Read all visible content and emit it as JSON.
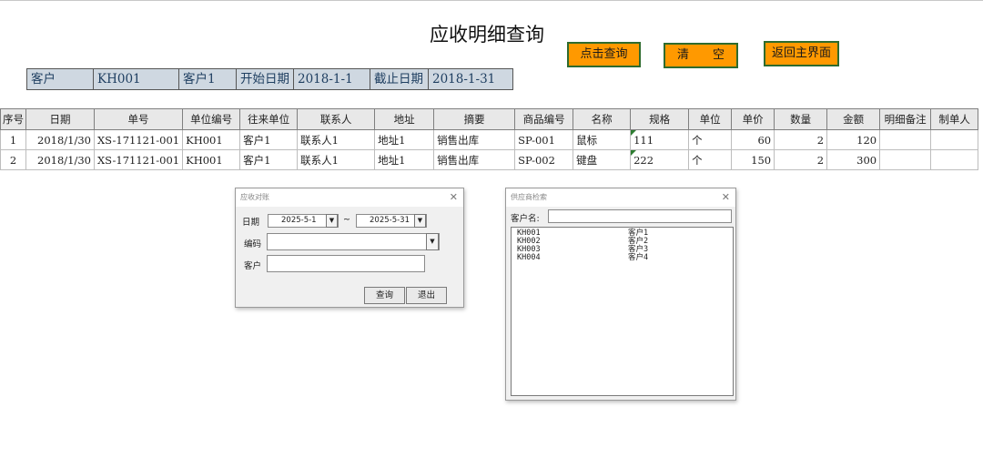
{
  "title": "应收明细查询",
  "buttons": {
    "query": "点击查询",
    "clear": "清　　空",
    "back": "返回主界面"
  },
  "filter": {
    "customer_label": "客户",
    "customer_code": "KH001",
    "customer_name": "客户1",
    "start_label": "开始日期",
    "start_date": "2018-1-1",
    "end_label": "截止日期",
    "end_date": "2018-1-31"
  },
  "table": {
    "headers": [
      "序号",
      "日期",
      "单号",
      "单位编号",
      "往来单位",
      "联系人",
      "地址",
      "摘要",
      "商品编号",
      "名称",
      "规格",
      "单位",
      "单价",
      "数量",
      "金额",
      "明细备注",
      "制单人"
    ],
    "rows": [
      [
        "1",
        "2018/1/30",
        "XS-171121-001",
        "KH001",
        "客户1",
        "联系人1",
        "地址1",
        "销售出库",
        "SP-001",
        "鼠标",
        "111",
        "个",
        "60",
        "2",
        "120",
        "",
        ""
      ],
      [
        "2",
        "2018/1/30",
        "XS-171121-001",
        "KH001",
        "客户1",
        "联系人1",
        "地址1",
        "销售出库",
        "SP-002",
        "键盘",
        "222",
        "个",
        "150",
        "2",
        "300",
        "",
        ""
      ]
    ]
  },
  "dialog1": {
    "title": "应收对账",
    "date_label": "日期",
    "date_from": "2025-5-1",
    "tilde": "~",
    "date_to": "2025-5-31",
    "code_label": "编码",
    "code_value": "",
    "customer_label": "客户",
    "customer_value": "",
    "query_button": "查询",
    "exit_button": "退出"
  },
  "dialog2": {
    "title": "供应商检索",
    "customer_label": "客户名:",
    "customer_value": "",
    "items": [
      {
        "code": "KH001",
        "name": "客户1"
      },
      {
        "code": "KH002",
        "name": "客户2"
      },
      {
        "code": "KH003",
        "name": "客户3"
      },
      {
        "code": "KH004",
        "name": "客户4"
      }
    ]
  },
  "colors": {
    "button_orange": "#ff9900",
    "button_border": "#2e6b2e",
    "filter_bg": "#cfd8e1",
    "filter_text": "#1f3f61",
    "marker_green": "#2e7d32"
  }
}
